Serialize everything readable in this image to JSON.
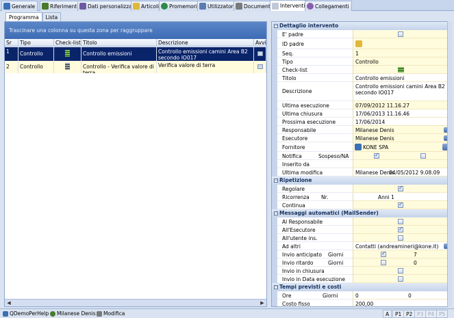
{
  "tabs": [
    {
      "label": "Generale",
      "icon": "edit-icon",
      "color": "#3b6fb6"
    },
    {
      "label": "Riferimenti",
      "icon": "people-icon",
      "color": "#4a7a2c"
    },
    {
      "label": "Dati personalizzati",
      "icon": "data-icon",
      "color": "#6d5aa0"
    },
    {
      "label": "Articoli",
      "icon": "folder-icon",
      "color": "#e0b83a"
    },
    {
      "label": "Promemoria",
      "icon": "reminder-icon",
      "color": "#2f8a4a"
    },
    {
      "label": "Utilizzatori",
      "icon": "users-icon",
      "color": "#5a7cb0"
    },
    {
      "label": "Documenti",
      "icon": "documents-icon",
      "color": "#7a7a7a"
    },
    {
      "label": "Interventi",
      "icon": "interventions-icon",
      "color": "#c0c8d8"
    },
    {
      "label": "Collegamenti",
      "icon": "links-icon",
      "color": "#8a5fb0"
    }
  ],
  "subtabs": [
    "Programma",
    "Lista"
  ],
  "grid": {
    "group_hint": "Trascinare una colonna su questa zona per raggruppare",
    "columns": [
      "Sr",
      "Tipo",
      "Check-list",
      "Titolo",
      "Descrizione",
      "Avvi"
    ],
    "rows": [
      {
        "sr": "1",
        "tipo": "Controllo",
        "titolo": "Controllo emissioni",
        "descrizione": "Controllo emissioni camini Area B2 secondo IO017"
      },
      {
        "sr": "2",
        "tipo": "Controllo",
        "titolo": "Controllo - Verifica valore di terra",
        "descrizione": "Verifica valore di terra"
      }
    ]
  },
  "details": {
    "section_intervento": "Dettaglio intervento",
    "epadre_label": "E' padre",
    "idpadre_label": "ID padre",
    "seq_label": "Seq.",
    "seq_value": "1",
    "tipo_label": "Tipo",
    "tipo_value": "Controllo",
    "checklist_label": "Check-list",
    "titolo_label": "Titolo",
    "titolo_value": "Controllo emissioni",
    "descrizione_label": "Descrizione",
    "descrizione_value": "Controllo emissioni camini Area B2 secondo IO017",
    "ultima_esecuzione_label": "Ultima esecuzione",
    "ultima_esecuzione_value": "07/09/2012 11.16.27",
    "ultima_chiusura_label": "Ultima chiusura",
    "ultima_chiusura_value": "17/06/2013 11.16.46",
    "prossima_esecuzione_label": "Prossima esecuzione",
    "prossima_esecuzione_value": "17/06/2014",
    "responsabile_label": "Responsabile",
    "responsabile_value": "Milanese Denis",
    "esecutore_label": "Esecutore",
    "esecutore_value": "Milanese Denis",
    "fornitore_label": "Fornitore",
    "fornitore_value": "KONE SPA",
    "notifica_label": "Notifica",
    "sospeso_label": "Sospeso/NA",
    "inserito_label": "Inserito da",
    "ultima_modifica_label": "Ultima modifica",
    "ultima_modifica_user": "Milanese Denis",
    "ultima_modifica_date": "04/05/2012 9.08.09",
    "section_ripetizione": "Ripetizione",
    "regolare_label": "Regolare",
    "ricorrenza_label": "Ricorrenza",
    "nr_label": "Nr.",
    "ricorrenza_value": "Anni 1",
    "continua_label": "Continua",
    "section_messaggi": "Messaggi automatici (MailSender)",
    "al_responsabile_label": "Al Responsabile",
    "all_esecutore_label": "All'Esecutore",
    "all_utente_label": "All'utente ins.",
    "ad_altri_label": "Ad altri",
    "ad_altri_value": "Contatti (andreamineri@kone.it)",
    "invio_anticipato_label": "Invio anticipato",
    "giorni_label": "Giorni",
    "invio_anticipato_value": "7",
    "invio_ritardo_label": "Invio ritardo",
    "invio_ritardo_value": "0",
    "invio_chiusura_label": "Invio in chiusura",
    "invio_data_label": "Invio in Data esecuzione",
    "section_tempi": "Tempi previsti e costi",
    "ore_label": "Ore",
    "ore_value": "0",
    "giorni_value": "0",
    "costo_label": "Costo fisso",
    "costo_value": "200,00"
  },
  "status": {
    "app": "QDemoPerHelp",
    "user": "Milanese Denis",
    "mode": "Modifica",
    "buttons": [
      "A",
      "P1",
      "P2",
      "P3",
      "P4",
      "P5"
    ]
  }
}
